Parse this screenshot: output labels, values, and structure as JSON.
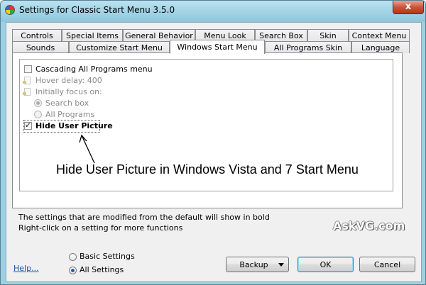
{
  "window": {
    "title": "Settings for Classic Start Menu 3.5.0",
    "close_label": "x"
  },
  "tabs": {
    "row1": [
      "Controls",
      "Special Items",
      "General Behavior",
      "Menu Look",
      "Search Box",
      "Skin",
      "Context Menu"
    ],
    "row2": [
      "Sounds",
      "Customize Start Menu",
      "Windows Start Menu",
      "All Programs Skin",
      "Language"
    ],
    "active": "Windows Start Menu"
  },
  "options": [
    {
      "label": "Cascading All Programs menu",
      "kind": "checkbox",
      "checked": false,
      "state": "normal"
    },
    {
      "label": "Hover delay: 400",
      "kind": "doc",
      "state": "disabled"
    },
    {
      "label": "Initially focus on:",
      "kind": "doc",
      "state": "disabled"
    },
    {
      "label": "Search box",
      "kind": "radio",
      "checked": true,
      "state": "disabled"
    },
    {
      "label": "All Programs",
      "kind": "radio",
      "checked": false,
      "state": "disabled"
    },
    {
      "label": "Hide User Picture",
      "kind": "checkbox",
      "checked": true,
      "state": "bold-selected"
    }
  ],
  "annotation": "Hide User Picture in Windows Vista and 7 Start Menu",
  "hints": {
    "line1": "The settings that are modified from the default will show in bold",
    "line2": "Right-click on a setting for more functions"
  },
  "watermark": "AskVG.com",
  "footer": {
    "help_link": "Help...",
    "mode_options": [
      {
        "label": "Basic Settings",
        "selected": false
      },
      {
        "label": "All Settings",
        "selected": true
      }
    ],
    "buttons": {
      "backup": "Backup",
      "ok": "OK",
      "cancel": "Cancel"
    }
  }
}
